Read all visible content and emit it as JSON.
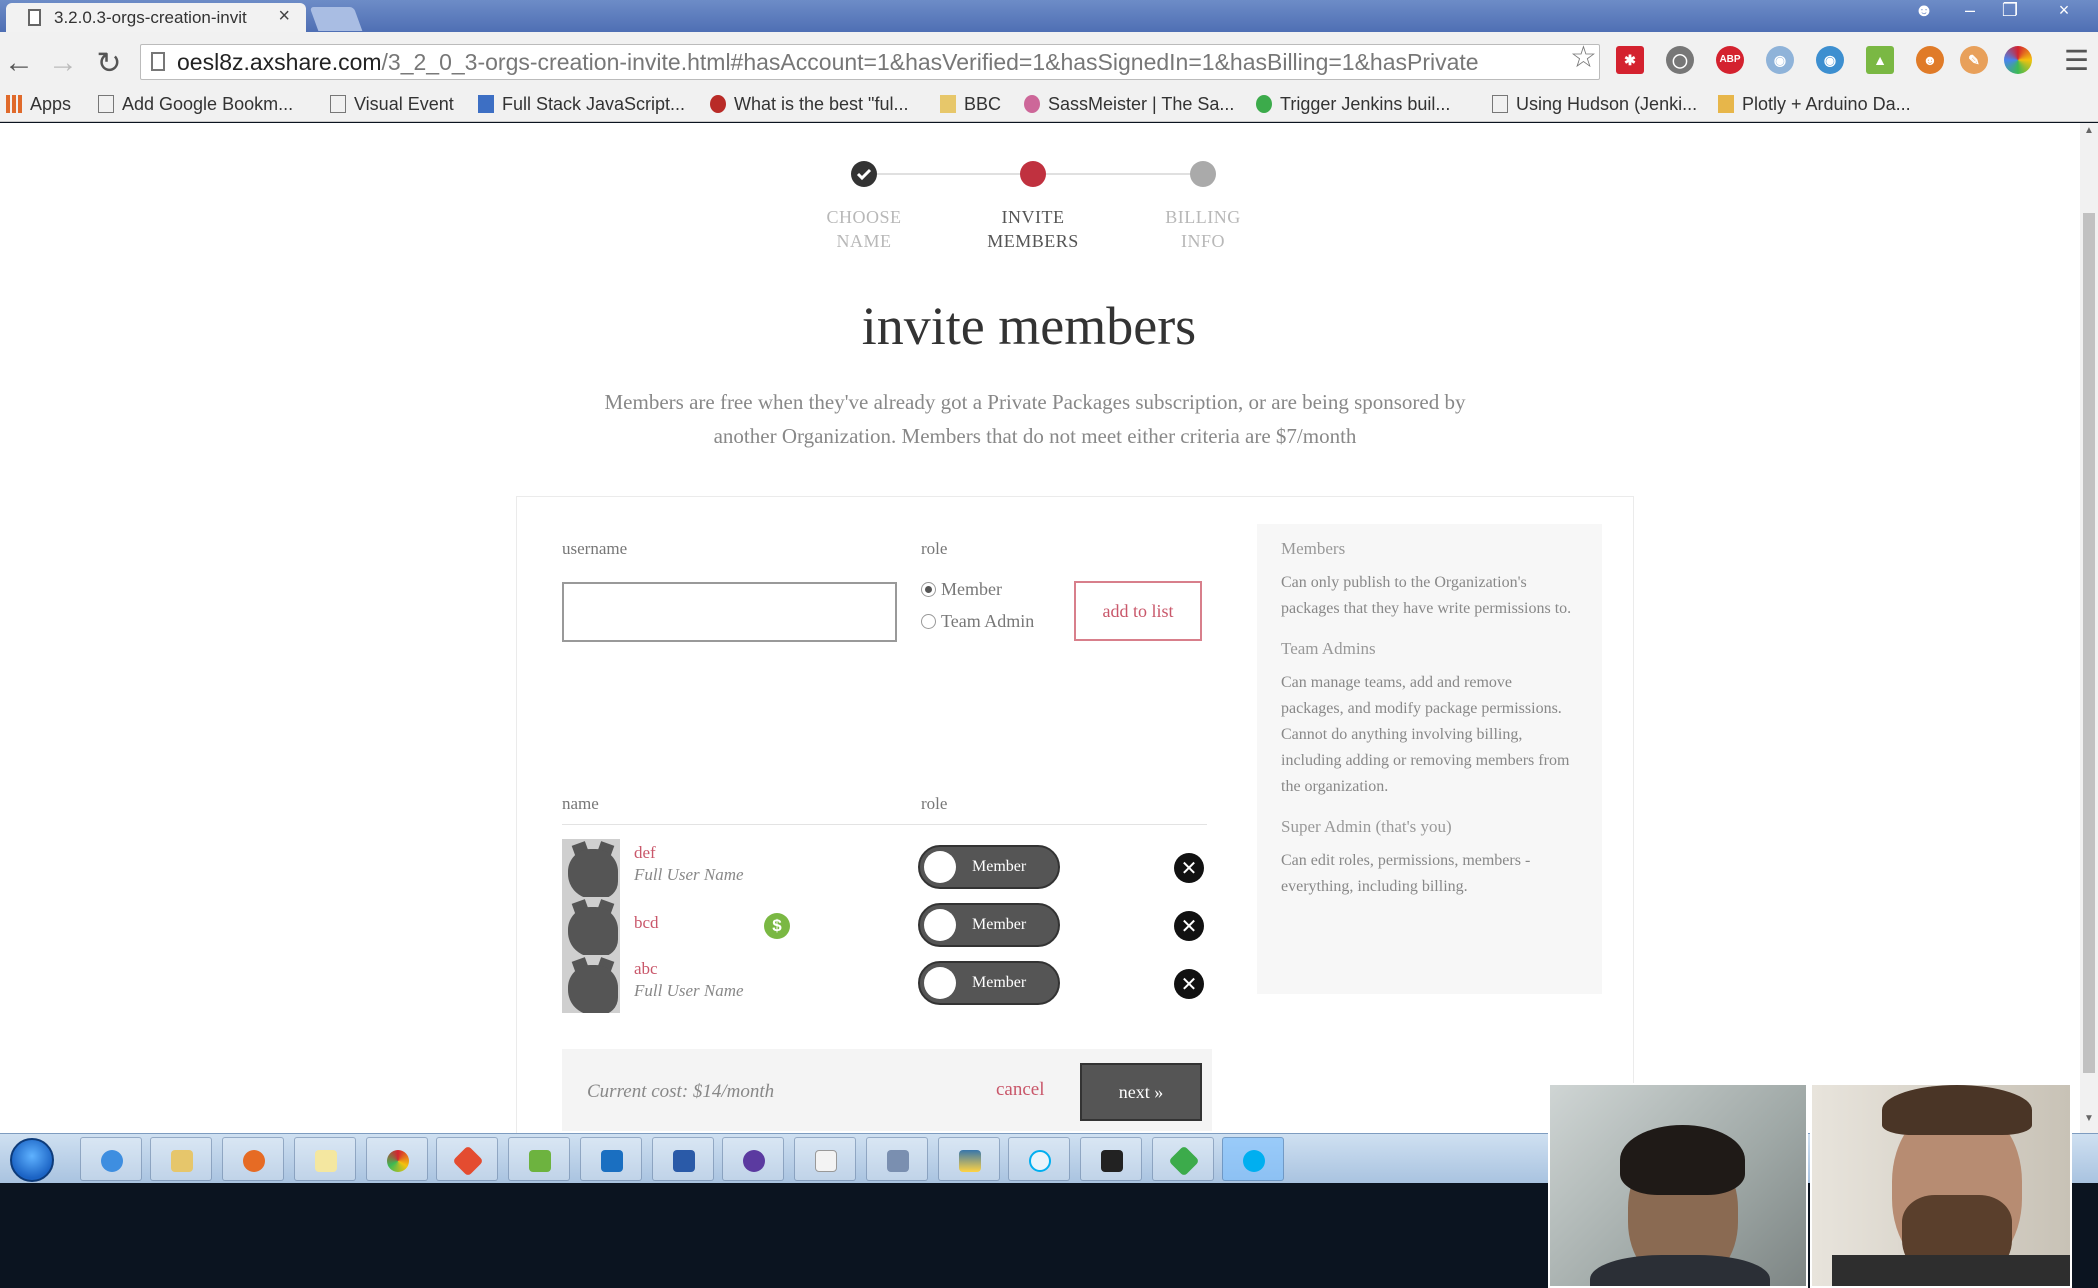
{
  "browser": {
    "tab_title": "3.2.0.3-orgs-creation-invit",
    "url_host": "oesl8z.axshare.com",
    "url_path": "/3_2_0_3-orgs-creation-invite.html#hasAccount=1&hasVerified=1&hasSignedIn=1&hasBilling=1&hasPrivate",
    "bookmarks": [
      "Apps",
      "Add Google Bookm...",
      "Visual Event",
      "Full Stack JavaScript...",
      "What is the best \"ful...",
      "BBC",
      "SassMeister | The Sa...",
      "Trigger Jenkins buil...",
      "Using Hudson (Jenki...",
      "Plotly + Arduino Da..."
    ],
    "extensions": [
      "lastpass-icon",
      "clock-icon",
      "adblock-icon",
      "camera-icon",
      "globe-icon",
      "android-icon",
      "people-icon",
      "brush-icon",
      "chrome-color-icon"
    ]
  },
  "stepper": {
    "steps": [
      {
        "label": "CHOOSE\nNAME",
        "state": "done"
      },
      {
        "label": "INVITE\nMEMBERS",
        "state": "active"
      },
      {
        "label": "BILLING\nINFO",
        "state": "pending"
      }
    ]
  },
  "page": {
    "heading": "invite members",
    "intro": "Members are free when they've already got a Private Packages subscription, or are being sponsored by another Organization. Members that do not meet either criteria are $7/month"
  },
  "form": {
    "username_label": "username",
    "username_value": "",
    "role_label": "role",
    "roles": [
      {
        "label": "Member",
        "checked": true
      },
      {
        "label": "Team Admin",
        "checked": false
      }
    ],
    "add_button": "add to list"
  },
  "members_table": {
    "col_name": "name",
    "col_role": "role",
    "rows": [
      {
        "username": "def",
        "full_name": "Full User Name",
        "role": "Member",
        "paid": false
      },
      {
        "username": "bcd",
        "full_name": "",
        "role": "Member",
        "paid": true
      },
      {
        "username": "abc",
        "full_name": "Full User Name",
        "role": "Member",
        "paid": false
      }
    ],
    "paid_symbol": "$",
    "remove_symbol": "✕"
  },
  "footer": {
    "cost": "Current cost: $14/month",
    "cancel": "cancel",
    "next": "next »"
  },
  "help": {
    "sections": [
      {
        "title": "Members",
        "text": "Can only publish to the Organization's packages that they have write permissions to."
      },
      {
        "title": "Team Admins",
        "text": "Can manage teams, add and remove packages, and modify package permissions. Cannot do anything involving billing, including adding or removing members from the organization."
      },
      {
        "title": "Super Admin (that's you)",
        "text": "Can edit roles, permissions, members - everything, including billing."
      }
    ]
  },
  "taskbar": {
    "apps": [
      "ie-icon",
      "explorer-icon",
      "firefox-icon",
      "notepad-icon",
      "chrome-icon",
      "git-icon",
      "snipping-icon",
      "outlook-icon",
      "brackets-icon",
      "obs-icon",
      "sheets-icon",
      "cube-icon",
      "python-icon",
      "skype-icon",
      "terminal-icon",
      "sourcetree-icon",
      "skype-active-icon"
    ]
  },
  "colors": {
    "accent": "#c9576a",
    "step_done": "#333333",
    "step_active": "#c0313f",
    "step_pending": "#aaaaaa",
    "paid_badge": "#7ab843"
  }
}
